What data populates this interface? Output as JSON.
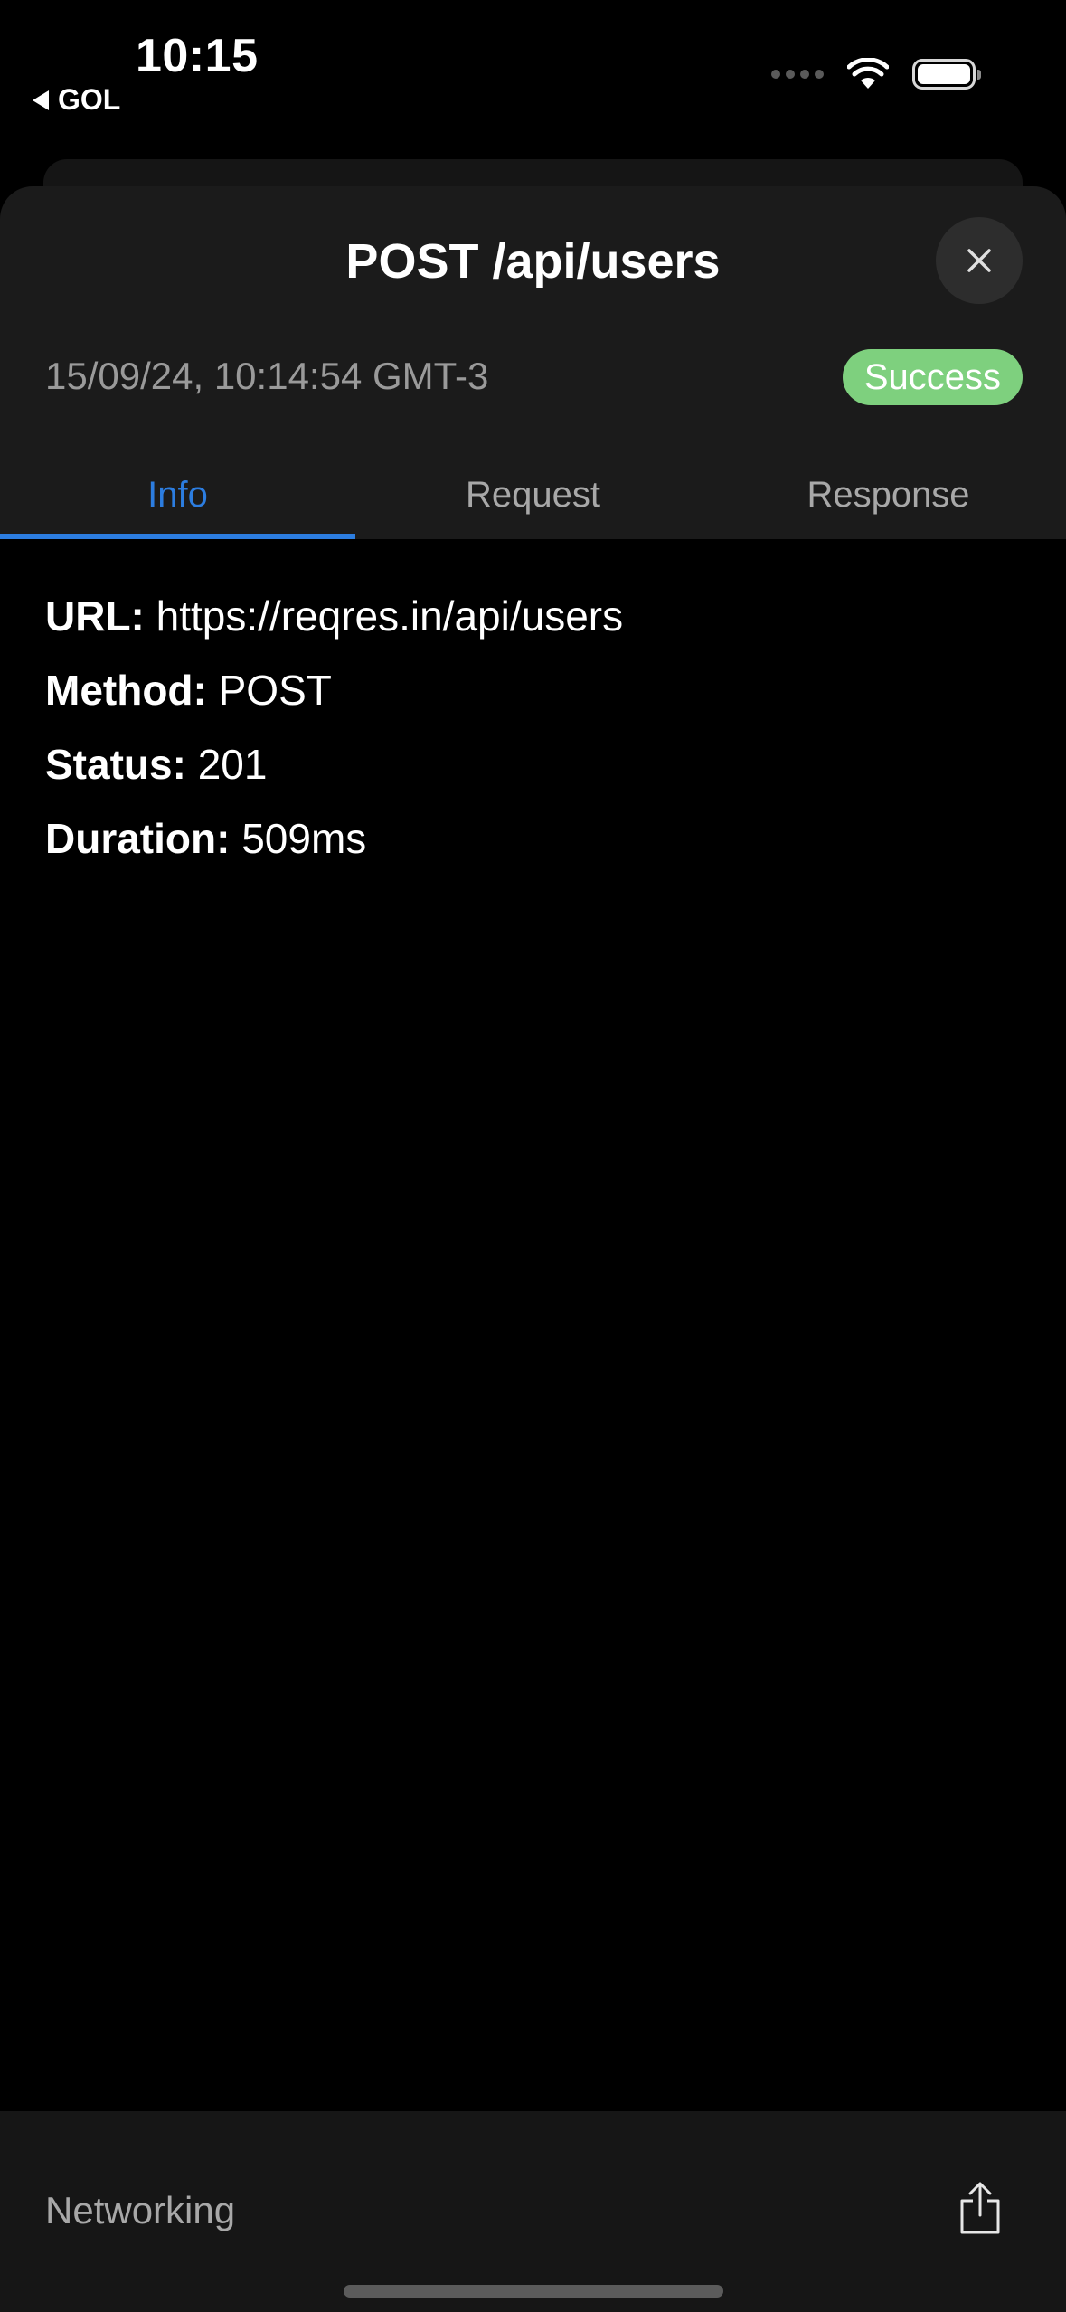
{
  "status_bar": {
    "time": "10:15",
    "back_app": "GOL"
  },
  "sheet": {
    "title": "POST /api/users",
    "timestamp": "15/09/24, 10:14:54 GMT-3",
    "status_badge": "Success",
    "status_badge_color": "#7ed07e",
    "accent_color": "#2c7de0",
    "tabs": [
      {
        "label": "Info",
        "active": true
      },
      {
        "label": "Request",
        "active": false
      },
      {
        "label": "Response",
        "active": false
      }
    ]
  },
  "info": {
    "url_label": "URL:",
    "url_value": "https://reqres.in/api/users",
    "method_label": "Method:",
    "method_value": "POST",
    "status_label": "Status:",
    "status_value": "201",
    "duration_label": "Duration:",
    "duration_value": "509ms"
  },
  "bottom_bar": {
    "label": "Networking",
    "share_icon": "share-icon"
  }
}
